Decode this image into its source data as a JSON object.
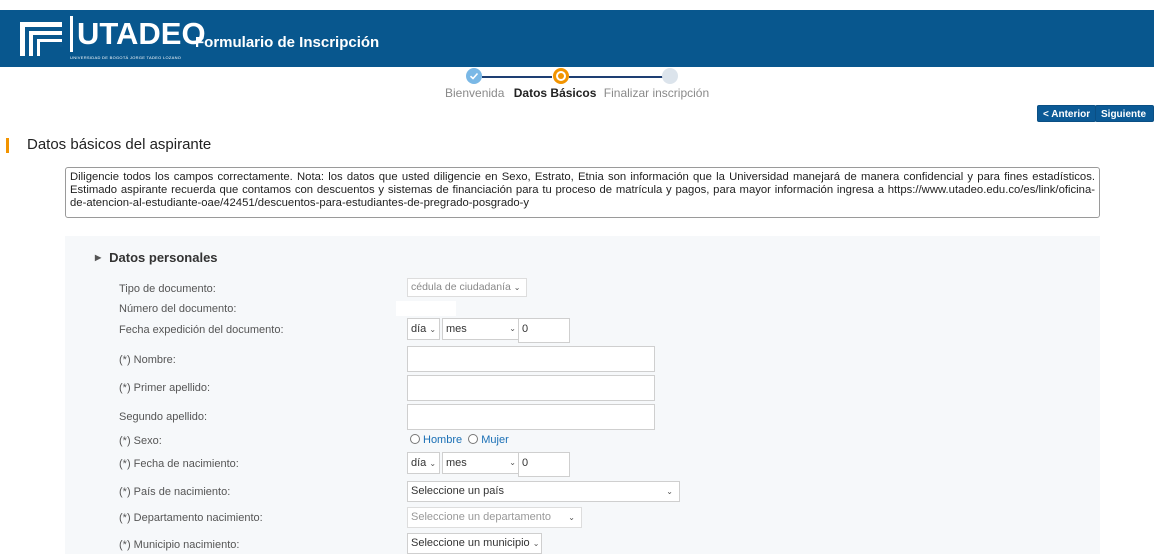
{
  "header": {
    "logo_text": "UTADEO",
    "logo_subtext": "UNIVERSIDAD DE BOGOTÁ JORGE TADEO LOZANO",
    "title": "Formulario de Inscripción",
    "background_color": "#08578e"
  },
  "stepper": {
    "steps": [
      "Bienvenida",
      "Datos Básicos",
      "Finalizar inscripción"
    ],
    "active_index": 1,
    "active_color": "#f29400"
  },
  "nav": {
    "prev_label": "< Anterior",
    "next_label": "Siguiente >"
  },
  "section": {
    "title": "Datos básicos del aspirante",
    "notice": "Diligencie todos los campos correctamente. Nota: los datos que usted diligencie en Sexo, Estrato, Etnia son información que la Universidad manejará de manera confidencial y para fines estadísticos. Estimado aspirante recuerda que contamos con descuentos y sistemas de financiación para tu proceso de matrícula y pagos, para mayor información ingresa a https://www.utadeo.edu.co/es/link/oficina-de-atencion-al-estudiante-oae/42451/descuentos-para-estudiantes-de-pregrado-posgrado-y"
  },
  "form": {
    "subsection_title": "Datos personales",
    "labels": {
      "tipo_documento": "Tipo de documento:",
      "numero_documento": "Número del documento:",
      "fecha_expedicion": "Fecha expedición del documento:",
      "nombre": "(*) Nombre:",
      "primer_apellido": "(*) Primer apellido:",
      "segundo_apellido": "Segundo apellido:",
      "sexo": "(*) Sexo:",
      "fecha_nacimiento": "(*) Fecha de nacimiento:",
      "pais_nacimiento": "(*) País de nacimiento:",
      "departamento_nacimiento": "(*) Departamento nacimiento:",
      "municipio_nacimiento": "(*) Municipio nacimiento:"
    },
    "values": {
      "tipo_documento": "cédula de ciudadanía",
      "dia": "día",
      "mes": "mes",
      "anio": "0",
      "nombre": "",
      "primer_apellido": "",
      "segundo_apellido": "",
      "sexo_options": [
        "Hombre",
        "Mujer"
      ],
      "pais": "Seleccione un país",
      "departamento": "Seleccione un departamento",
      "municipio": "Seleccione un municipio"
    }
  }
}
